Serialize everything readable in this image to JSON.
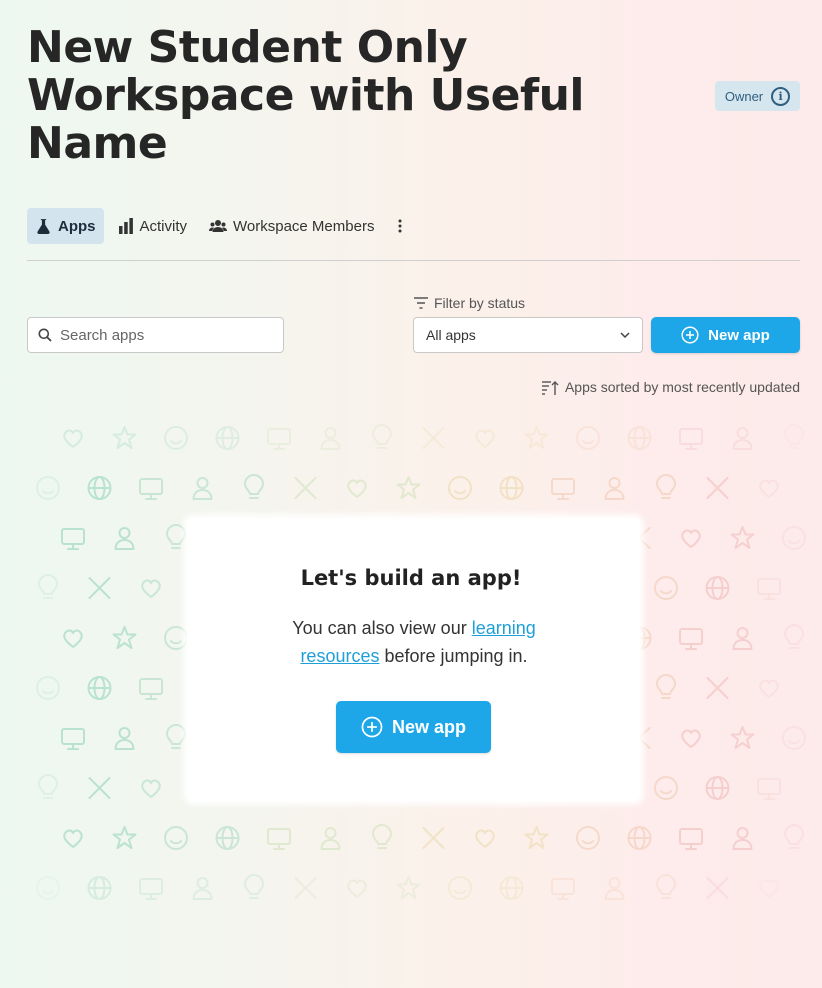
{
  "header": {
    "title": "New Student Only Workspace with Useful Name",
    "role_badge": "Owner"
  },
  "tabs": [
    {
      "label": "Apps",
      "icon": "flask-icon",
      "active": true
    },
    {
      "label": "Activity",
      "icon": "bar-chart-icon",
      "active": false
    },
    {
      "label": "Workspace Members",
      "icon": "users-icon",
      "active": false
    }
  ],
  "toolbar": {
    "search_placeholder": "Search apps",
    "filter_label": "Filter by status",
    "filter_selected": "All apps",
    "new_app_label": "New app",
    "sort_note": "Apps sorted by most recently updated"
  },
  "empty_state": {
    "title": "Let's build an app!",
    "text_before": "You can also view our ",
    "link_text": "learning resources",
    "text_after": " before jumping in.",
    "button_label": "New app"
  },
  "colors": {
    "primary": "#1ea7e8",
    "active_tab_bg": "#d3e4ee",
    "badge_bg": "#d6e6ef",
    "link": "#1f9fd9"
  }
}
